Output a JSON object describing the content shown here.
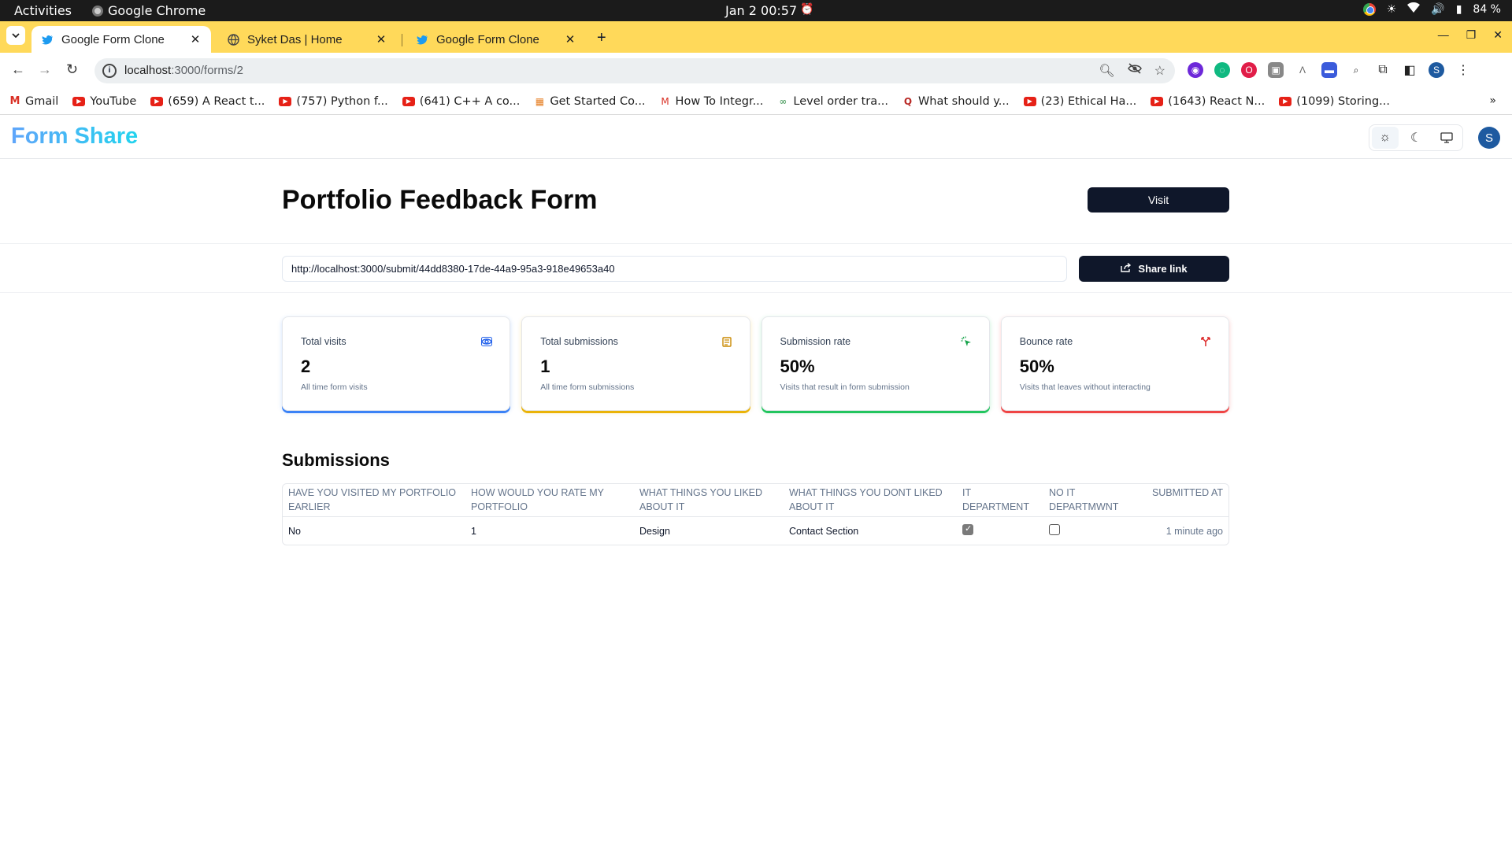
{
  "os": {
    "activities": "Activities",
    "app_name": "Google Chrome",
    "clock": "Jan 2  00:57",
    "battery": "84 %"
  },
  "tabs": [
    {
      "title": "Google Form Clone",
      "active": true
    },
    {
      "title": "Syket Das | Home",
      "active": false
    },
    {
      "title": "Google Form Clone",
      "active": false
    }
  ],
  "address": {
    "host": "localhost",
    "path": ":3000/forms/2"
  },
  "bookmarks": [
    {
      "label": "Gmail",
      "icon": "gmail-icon"
    },
    {
      "label": "YouTube",
      "icon": "youtube-icon"
    },
    {
      "label": "(659) A React t...",
      "icon": "youtube-icon"
    },
    {
      "label": "(757) Python f...",
      "icon": "youtube-icon"
    },
    {
      "label": "(641) C++ A co...",
      "icon": "youtube-icon"
    },
    {
      "label": "Get Started Co...",
      "icon": "page-icon"
    },
    {
      "label": "How To Integr...",
      "icon": "medium-icon"
    },
    {
      "label": "Level order tra...",
      "icon": "gfg-icon"
    },
    {
      "label": "What should y...",
      "icon": "quora-icon"
    },
    {
      "label": "(23) Ethical Ha...",
      "icon": "youtube-icon"
    },
    {
      "label": "(1643) React N...",
      "icon": "youtube-icon"
    },
    {
      "label": "(1099) Storing...",
      "icon": "youtube-icon"
    }
  ],
  "app": {
    "logo": "Form Share",
    "avatar_letter": "S"
  },
  "form": {
    "title": "Portfolio Feedback Form",
    "visit_label": "Visit",
    "share_url": "http://localhost:3000/submit/44dd8380-17de-44a9-95a3-918e49653a40",
    "share_label": "Share link"
  },
  "stats": [
    {
      "title": "Total visits",
      "value": "2",
      "sub": "All time form visits",
      "color": "#3b82f6",
      "icon": "eye-icon"
    },
    {
      "title": "Total submissions",
      "value": "1",
      "sub": "All time form submissions",
      "color": "#eab308",
      "icon": "document-icon"
    },
    {
      "title": "Submission rate",
      "value": "50%",
      "sub": "Visits that result in form submission",
      "color": "#22c55e",
      "icon": "cursor-click-icon"
    },
    {
      "title": "Bounce rate",
      "value": "50%",
      "sub": "Visits that leaves without interacting",
      "color": "#ef4444",
      "icon": "split-arrow-icon"
    }
  ],
  "submissions": {
    "title": "Submissions",
    "columns": [
      "Have you visited my portfolio earlier",
      "How would you rate my portfolio",
      "What things you liked about it",
      "What things you dont liked about it",
      "IT department",
      "No IT departmwnt",
      "Submitted at"
    ],
    "rows": [
      {
        "visited": "No",
        "rating": "1",
        "liked": "Design",
        "disliked": "Contact Section",
        "it_department": true,
        "no_it_department": false,
        "submitted_at": "1 minute ago"
      }
    ]
  }
}
